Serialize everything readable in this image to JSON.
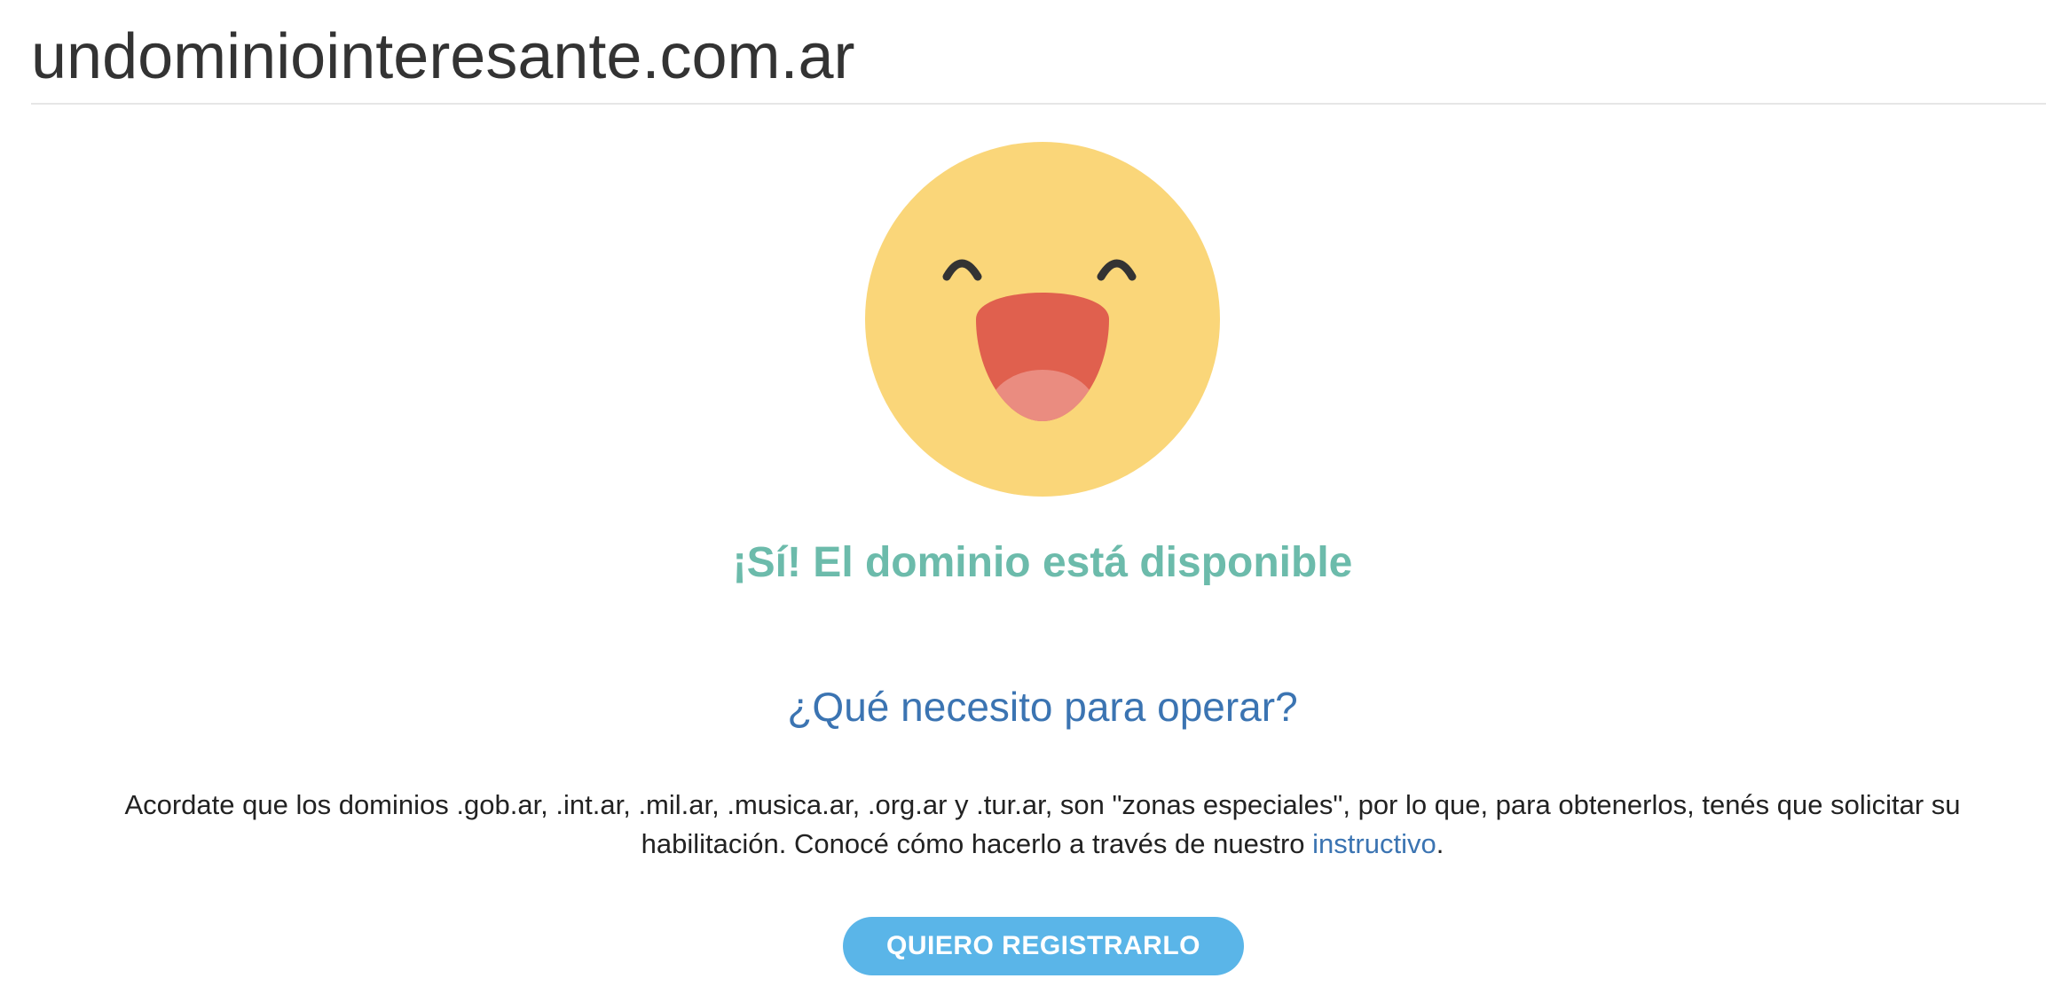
{
  "header": {
    "domain": "undominiointeresante.com.ar"
  },
  "result": {
    "emoji": "happy-face-icon",
    "status": "¡Sí! El dominio está disponible"
  },
  "info": {
    "heading": "¿Qué necesito para operar?",
    "text_before_link": "Acordate que los dominios .gob.ar, .int.ar, .mil.ar, .musica.ar, .org.ar y .tur.ar, son \"zonas especiales\", por lo que, para obtenerlos, tenés que solicitar su habilitación. Conocé cómo hacerlo a través de nuestro ",
    "link_label": "instructivo",
    "text_after_link": "."
  },
  "actions": {
    "register_label": "QUIERO REGISTRARLO"
  },
  "colors": {
    "available_text": "#6cbbab",
    "heading_text": "#3b74b2",
    "button_bg": "#5ab5e8",
    "emoji_face": "#fad679",
    "emoji_mouth": "#e0604e",
    "emoji_tongue": "#ea8c80"
  }
}
